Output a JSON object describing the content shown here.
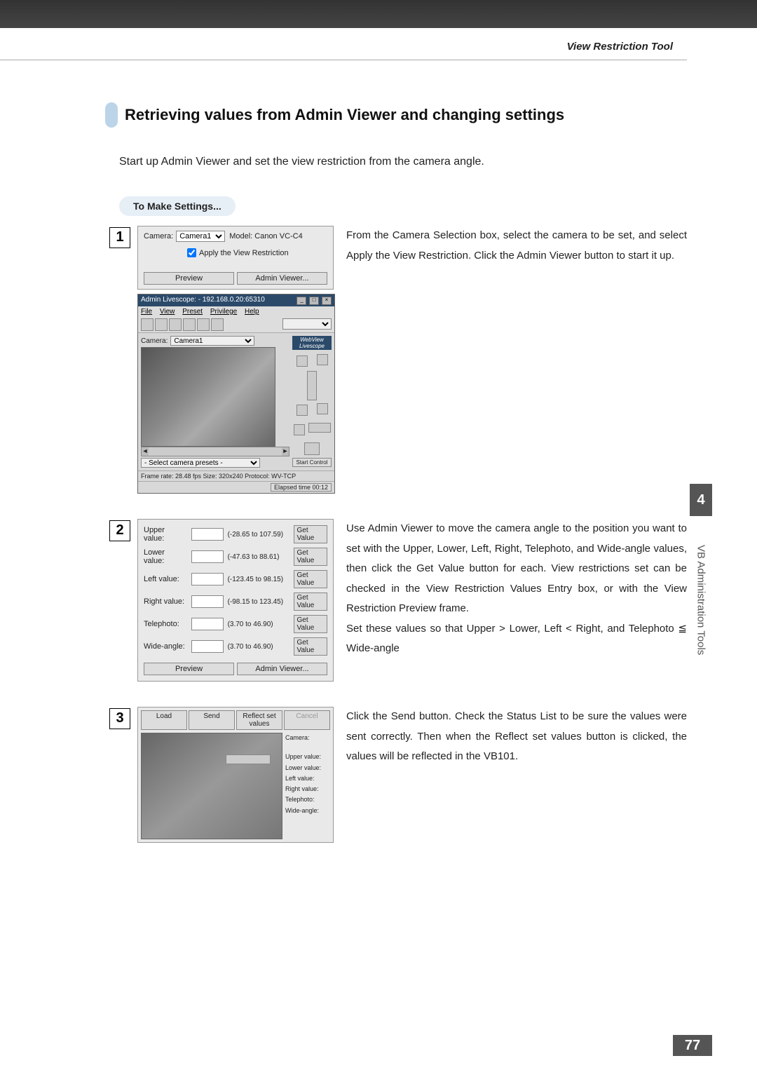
{
  "header": {
    "tool_name": "View Restriction Tool"
  },
  "section": {
    "title": "Retrieving values from Admin Viewer and changing settings",
    "intro": "Start up Admin Viewer and set the view restriction from the camera angle.",
    "subhead": "To Make Settings..."
  },
  "step1": {
    "num": "1",
    "panel": {
      "camera_label": "Camera:",
      "camera_value": "Camera1",
      "model_label": "Model: Canon VC-C4",
      "apply_label": "Apply the View Restriction",
      "preview_btn": "Preview",
      "adminviewer_btn": "Admin Viewer..."
    },
    "livescope": {
      "title": "Admin Livescope: - 192.168.0.20:65310",
      "menu_file": "File",
      "menu_view": "View",
      "menu_preset": "Preset",
      "menu_privilege": "Privilege",
      "menu_help": "Help",
      "camera_label": "Camera:",
      "camera_value": "Camera1",
      "brand": "WebView Livescope",
      "preset_label": "- Select camera presets -",
      "start_control": "Start Control",
      "status": "Frame rate: 28.48 fps   Size: 320x240   Protocol: WV-TCP",
      "elapsed": "Elapsed time 00:12"
    },
    "desc": "From the Camera Selection box, select the camera to be set, and select Apply the View Restriction. Click the Admin Viewer button to start it up."
  },
  "step2": {
    "num": "2",
    "rows": [
      {
        "label": "Upper value:",
        "range": "(-28.65 to 107.59)"
      },
      {
        "label": "Lower value:",
        "range": "(-47.63 to 88.61)"
      },
      {
        "label": "Left value:",
        "range": "(-123.45 to 98.15)"
      },
      {
        "label": "Right value:",
        "range": "(-98.15 to 123.45)"
      },
      {
        "label": "Telephoto:",
        "range": "(3.70 to 46.90)"
      },
      {
        "label": "Wide-angle:",
        "range": "(3.70 to 46.90)"
      }
    ],
    "get_value": "Get Value",
    "preview_btn": "Preview",
    "adminviewer_btn": "Admin Viewer...",
    "desc": "Use Admin Viewer to move the camera angle to the position you want to set with the Upper, Lower, Left, Right, Telephoto, and Wide-angle values, then click the Get Value button for each. View restrictions set can be checked in the View Restriction Values Entry box, or with the View Restriction Preview frame.",
    "desc2": "Set these values so that Upper > Lower, Left < Right, and Telephoto ≦ Wide-angle"
  },
  "step3": {
    "num": "3",
    "buttons": {
      "load": "Load",
      "send": "Send",
      "reflect": "Reflect set values",
      "cancel": "Cancel"
    },
    "sidelabels": {
      "camera": "Camera:",
      "upper": "Upper value:",
      "lower": "Lower value:",
      "left": "Left value:",
      "right": "Right value:",
      "telephoto": "Telephoto:",
      "wide": "Wide-angle:"
    },
    "desc": "Click the Send button. Check the Status List to be sure the values were sent correctly. Then when the Reflect set values button is clicked, the values will be reflected in the VB101."
  },
  "side_tab": {
    "num": "4",
    "label": "VB Administration Tools"
  },
  "page_number": "77"
}
